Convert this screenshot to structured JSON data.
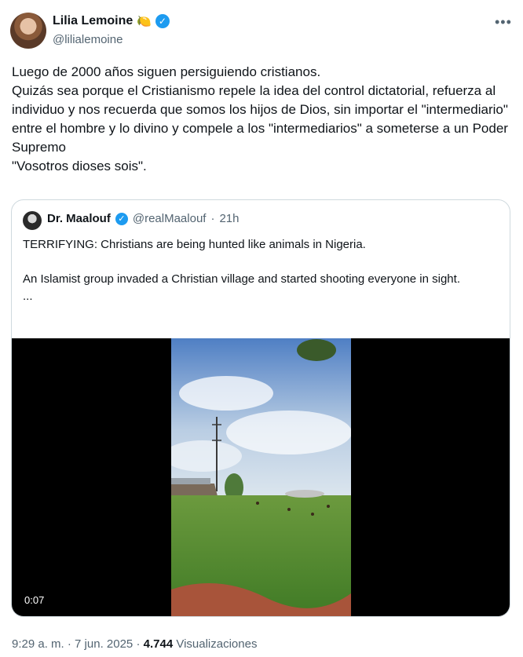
{
  "author": {
    "name": "Lilia Lemoine",
    "emoji": "🍋",
    "handle": "@lilialemoine"
  },
  "more_icon": "more-horizontal-icon",
  "tweet_text": "Luego de 2000 años siguen persiguiendo cristianos.\nQuizás sea porque el Cristianismo repele la idea del control dictatorial, refuerza al individuo y nos recuerda que somos los hijos de Dios, sin importar el \"intermediario\" entre el hombre y lo divino y compele a los \"intermediarios\" a someterse a un Poder Supremo\n\"Vosotros dioses sois\".",
  "quoted": {
    "name": "Dr. Maalouf",
    "handle": "@realMaalouf",
    "dot": "·",
    "time": "21h",
    "text": "TERRIFYING: Christians are being hunted like animals in Nigeria.\n\nAn Islamist group invaded a Christian village and started shooting everyone in sight.\n...",
    "video_duration": "0:07"
  },
  "footer": {
    "time": "9:29 a. m.",
    "dot": "·",
    "date": "7 jun. 2025",
    "views": "4.744",
    "views_label": "Visualizaciones"
  },
  "colors": {
    "verified": "#1d9bf0",
    "secondary_text": "#536471",
    "border": "#cfd9de"
  }
}
